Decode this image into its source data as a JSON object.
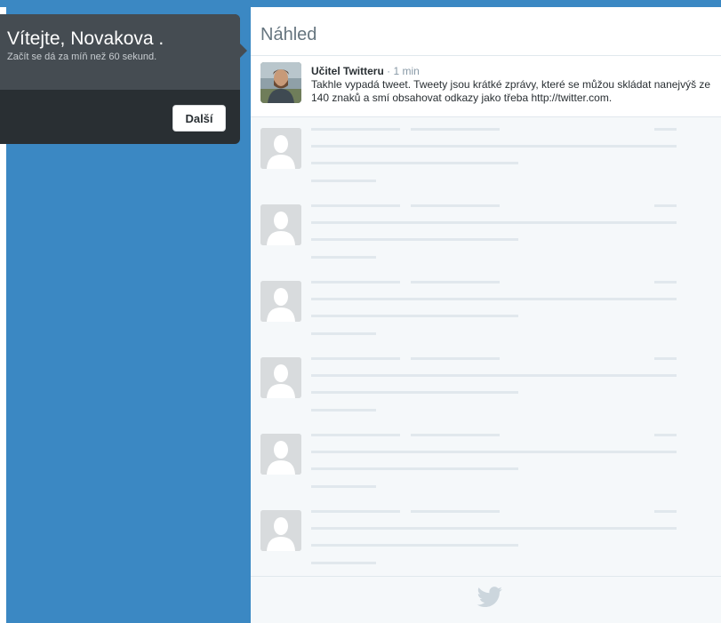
{
  "welcome": {
    "title": "Vítejte, Novakova .",
    "subtitle": "Začít se dá za míň než 60 sekund.",
    "next_label": "Další"
  },
  "preview": {
    "title": "Náhled",
    "tweet": {
      "name": "Učitel Twitteru",
      "separator": " · ",
      "time": "1 min",
      "text": "Takhle vypadá tweet. Tweety jsou krátké zprávy, které se můžou skládat nanejvýš ze 140 znaků a smí obsahovat odkazy jako třeba http://twitter.com."
    },
    "placeholder_count": 6
  },
  "colors": {
    "background_blue": "#3b88c3",
    "card_dark": "#292f33",
    "placeholder": "#e1e8ed"
  },
  "icons": {
    "footer": "twitter-bird-icon",
    "placeholder_avatar": "default-avatar-icon"
  }
}
